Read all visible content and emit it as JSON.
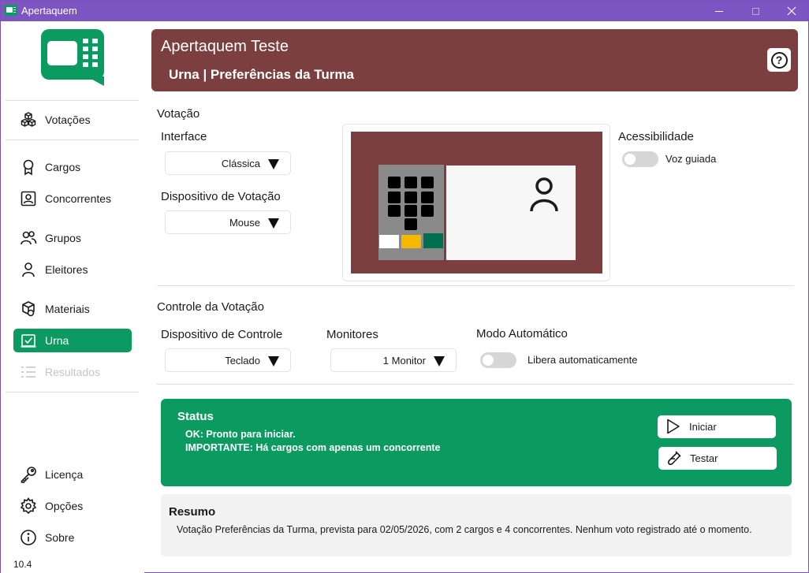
{
  "window": {
    "title": "Apertaquem"
  },
  "sidebar": {
    "items": [
      {
        "label": "Votações",
        "icon": "cubes-icon"
      },
      {
        "label": "Cargos",
        "icon": "award-icon"
      },
      {
        "label": "Concorrentes",
        "icon": "contact-card-icon"
      },
      {
        "label": "Grupos",
        "icon": "people-icon"
      },
      {
        "label": "Eleitores",
        "icon": "person-icon"
      },
      {
        "label": "Materiais",
        "icon": "materials-icon"
      },
      {
        "label": "Urna",
        "icon": "ballot-box-icon",
        "active": true
      },
      {
        "label": "Resultados",
        "icon": "list-icon",
        "disabled": true
      },
      {
        "label": "Licença",
        "icon": "key-icon"
      },
      {
        "label": "Opções",
        "icon": "gear-icon"
      },
      {
        "label": "Sobre",
        "icon": "info-icon"
      }
    ],
    "version": "10.4"
  },
  "header": {
    "app_name": "Apertaquem Teste",
    "page_title": "Urna | Preferências da Turma",
    "help_symbol": "?"
  },
  "votacao": {
    "section_title": "Votação",
    "interface_label": "Interface",
    "interface_value": "Clássica",
    "device_label": "Dispositivo de Votação",
    "device_value": "Mouse",
    "accessibility_label": "Acessibilidade",
    "voice_label": "Voz guiada",
    "voice_enabled": false
  },
  "controle": {
    "section_title": "Controle da Votação",
    "control_device_label": "Dispositivo de Controle",
    "control_device_value": "Teclado",
    "monitors_label": "Monitores",
    "monitors_value": "1 Monitor",
    "auto_mode_label": "Modo Automático",
    "auto_release_label": "Libera automaticamente",
    "auto_release_enabled": false
  },
  "status": {
    "title": "Status",
    "line1": "OK: Pronto para iniciar.",
    "line2": "IMPORTANTE: Há cargos com apenas um concorrente",
    "start_label": "Iniciar",
    "test_label": "Testar"
  },
  "resumo": {
    "title": "Resumo",
    "text": "Votação Preferências da Turma, prevista para 02/05/2026, com 2 cargos e 4 concorrentes. Nenhum voto registrado até o momento."
  },
  "colors": {
    "titlebar": "#7d55c2",
    "accent_green": "#0b9a5f",
    "header_brown": "#7b3f3f",
    "keypad_white": "#ffffff",
    "keypad_yellow": "#f5b800",
    "keypad_green": "#006e50"
  }
}
